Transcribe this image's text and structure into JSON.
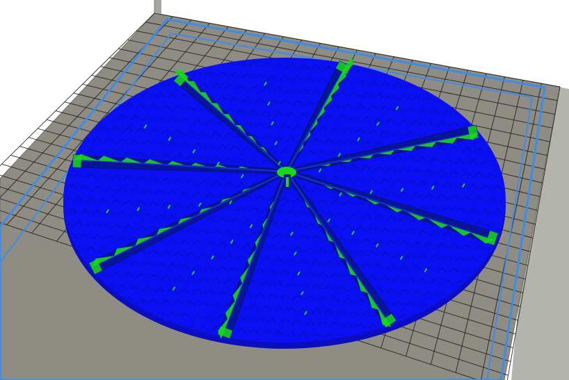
{
  "viewport": {
    "name": "3d-print-preview",
    "background": "#ffffff"
  },
  "bed": {
    "plate_color": "#8e8c83",
    "grid_color": "#1e1e1e",
    "grid_lines": 22,
    "boundary_color": "#3b8dea",
    "side_wall_color": "#9c9c96"
  },
  "model": {
    "shape": "disc",
    "spoke_count": 8,
    "top_color": "#0a10f2",
    "edge_color": "#0a0ec0",
    "spoke_color": "#081596",
    "support_color": "#18d81a",
    "infill_color": "#06109a"
  }
}
